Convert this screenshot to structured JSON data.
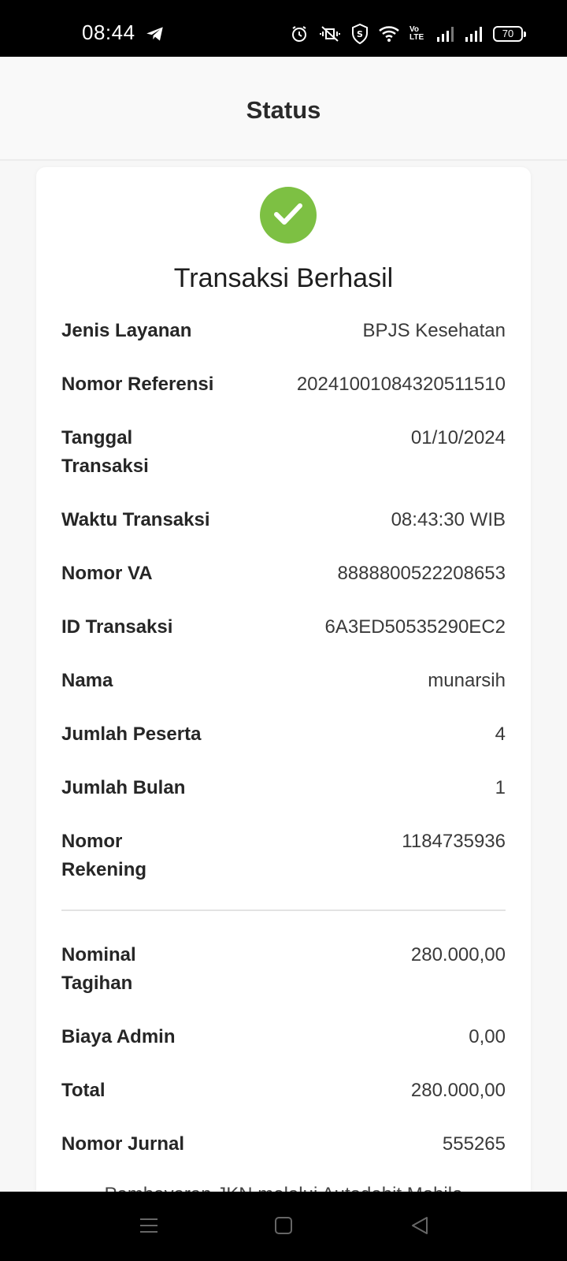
{
  "status_bar": {
    "time": "08:44",
    "battery": "70",
    "volte": "Vo LTE"
  },
  "header": {
    "title": "Status"
  },
  "result": {
    "title": "Transaksi Berhasil",
    "accent_color": "#7dc043"
  },
  "details": [
    {
      "label": "Jenis Layanan",
      "value": "BPJS Kesehatan"
    },
    {
      "label": "Nomor Referensi",
      "value": "20241001084320511510"
    },
    {
      "label": "Tanggal Transaksi",
      "value": "01/10/2024"
    },
    {
      "label": "Waktu Transaksi",
      "value": "08:43:30 WIB"
    },
    {
      "label": "Nomor VA",
      "value": "8888800522208653"
    },
    {
      "label": "ID Transaksi",
      "value": "6A3ED50535290EC2"
    },
    {
      "label": "Nama",
      "value": "munarsih"
    },
    {
      "label": "Jumlah Peserta",
      "value": "4"
    },
    {
      "label": "Jumlah Bulan",
      "value": "1"
    },
    {
      "label": "Nomor Rekening",
      "value": "1184735936"
    }
  ],
  "amounts": [
    {
      "label": "Nominal Tagihan",
      "value": "280.000,00"
    },
    {
      "label": "Biaya Admin",
      "value": "0,00"
    },
    {
      "label": "Total",
      "value": "280.000,00"
    },
    {
      "label": "Nomor Jurnal",
      "value": "555265"
    }
  ],
  "footnote": "Pembayaran JKN melalui Autodebit Mobile",
  "navbar": {
    "menu_icon": "menu-icon",
    "home_icon": "home-icon",
    "back_icon": "back-icon"
  }
}
